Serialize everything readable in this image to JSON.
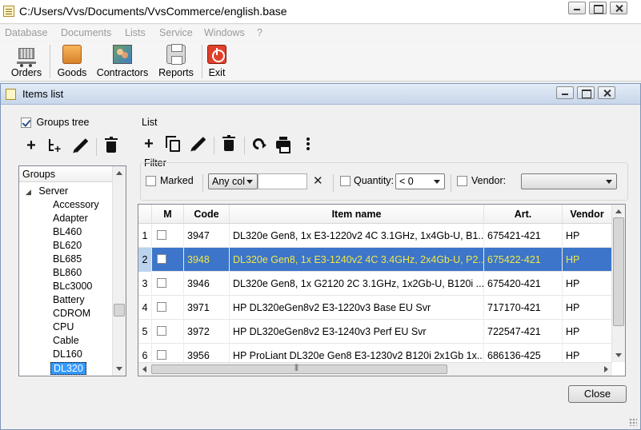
{
  "window": {
    "title": "C:/Users/Vvs/Documents/VvsCommerce/english.base"
  },
  "menu": [
    "Database",
    "Documents",
    "Lists",
    "Service",
    "Windows",
    "?"
  ],
  "toolbar": {
    "orders": "Orders",
    "goods": "Goods",
    "contractors": "Contractors",
    "reports": "Reports",
    "exit": "Exit"
  },
  "child_window": {
    "title": "Items list"
  },
  "groups": {
    "checkbox_label": "Groups tree",
    "checked": true,
    "header": "Groups",
    "root": "Server",
    "items": [
      "Accessory",
      "Adapter",
      "BL460",
      "BL620",
      "BL685",
      "BL860",
      "BLc3000",
      "Battery",
      "CDROM",
      "CPU",
      "Cable",
      "DL160",
      "DL320"
    ],
    "selected": "DL320"
  },
  "list": {
    "label": "List",
    "filter_label": "Filter",
    "marked_label": "Marked",
    "column_combo": "Any col",
    "search_value": "",
    "quantity_label": "Quantity:",
    "quantity_combo": "< 0",
    "vendor_label": "Vendor:",
    "vendor_combo": ""
  },
  "table": {
    "headers": [
      "",
      "M",
      "Code",
      "Item name",
      "Art.",
      "Vendor"
    ],
    "rows": [
      {
        "n": "1",
        "code": "3947",
        "name": "DL320e Gen8, 1x E3-1220v2 4C 3.1GHz, 1x4Gb-U, B1...",
        "art": "675421-421",
        "vendor": "HP"
      },
      {
        "n": "2",
        "code": "3948",
        "name": "DL320e Gen8, 1x E3-1240v2 4C 3.4GHz, 2x4Gb-U, P2...",
        "art": "675422-421",
        "vendor": "HP"
      },
      {
        "n": "3",
        "code": "3946",
        "name": "DL320e Gen8, 1x G2120 2C 3.1GHz, 1x2Gb-U, B120i ...",
        "art": "675420-421",
        "vendor": "HP"
      },
      {
        "n": "4",
        "code": "3971",
        "name": "HP DL320eGen8v2 E3-1220v3 Base EU Svr",
        "art": "717170-421",
        "vendor": "HP"
      },
      {
        "n": "5",
        "code": "3972",
        "name": "HP DL320eGen8v2 E3-1240v3 Perf EU Svr",
        "art": "722547-421",
        "vendor": "HP"
      },
      {
        "n": "6",
        "code": "3956",
        "name": "HP ProLiant DL320e Gen8 E3-1230v2 B120i 2x1Gb 1x...",
        "art": "686136-425",
        "vendor": "HP"
      }
    ],
    "selected_row": 1
  },
  "buttons": {
    "close": "Close"
  }
}
